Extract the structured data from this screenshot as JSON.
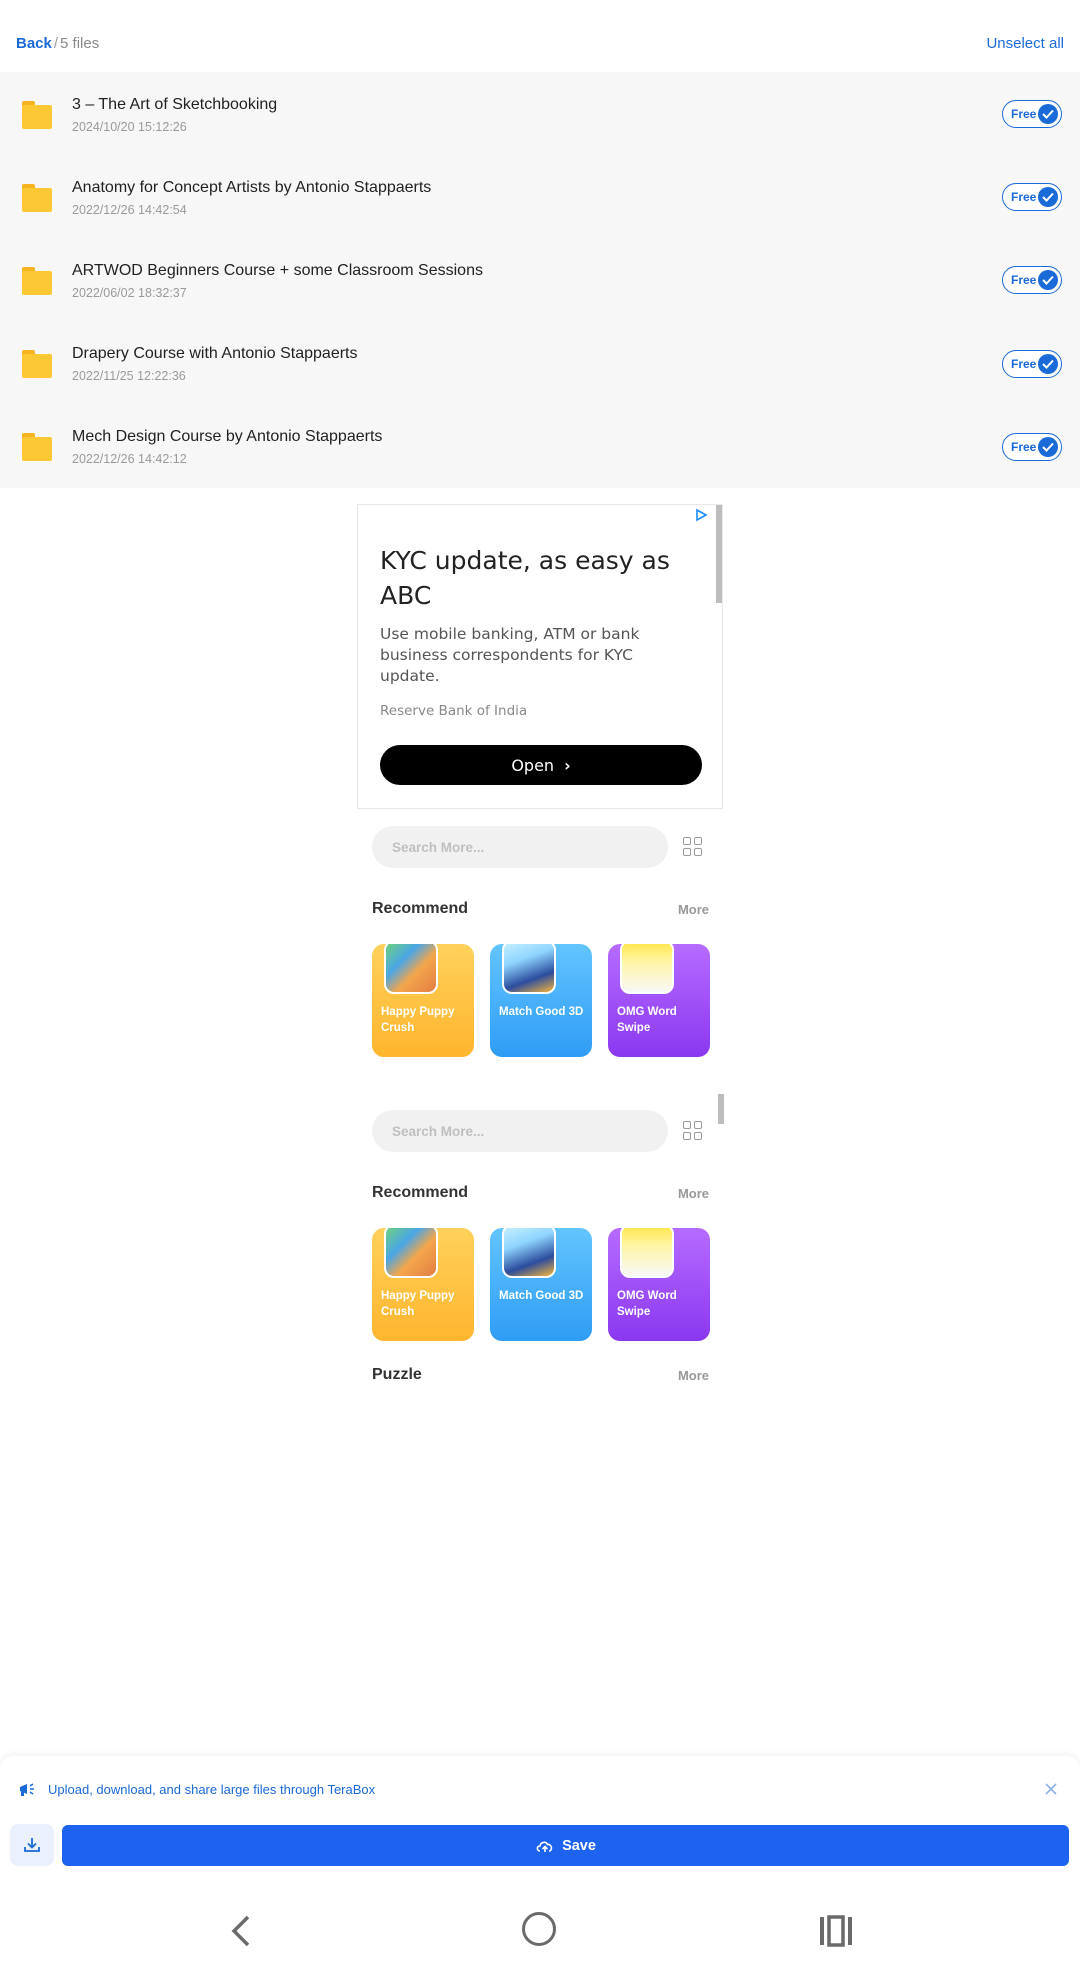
{
  "header": {
    "back_label": "Back",
    "separator": "/",
    "file_count": "5 files",
    "unselect_label": "Unselect all"
  },
  "files": [
    {
      "name": "3 – The Art of Sketchbooking",
      "date": "2024/10/20 15:12:26",
      "badge": "Free"
    },
    {
      "name": "Anatomy for Concept Artists by Antonio Stappaerts",
      "date": "2022/12/26 14:42:54",
      "badge": "Free"
    },
    {
      "name": "ARTWOD Beginners Course + some Classroom Sessions",
      "date": "2022/06/02 18:32:37",
      "badge": "Free"
    },
    {
      "name": "Drapery Course with Antonio Stappaerts",
      "date": "2022/11/25 12:22:36",
      "badge": "Free"
    },
    {
      "name": "Mech Design Course by Antonio Stappaerts",
      "date": "2022/12/26 14:42:12",
      "badge": "Free"
    }
  ],
  "ad": {
    "headline": "KYC update, as easy as ABC",
    "body": "Use mobile banking, ATM or bank business correspondents for KYC update.",
    "source": "Reserve Bank of India",
    "button": "Open",
    "choice_icon": "ad-choices-icon"
  },
  "games_widget_1": {
    "search_placeholder": "Search More...",
    "recommend_title": "Recommend",
    "more_label": "More",
    "games": [
      {
        "name": "Happy Puppy Crush"
      },
      {
        "name": "Match Good 3D"
      },
      {
        "name": "OMG Word Swipe"
      }
    ]
  },
  "games_widget_2": {
    "search_placeholder": "Search More...",
    "recommend_title": "Recommend",
    "more_label": "More",
    "games": [
      {
        "name": "Happy Puppy Crush"
      },
      {
        "name": "Match Good 3D"
      },
      {
        "name": "OMG Word Swipe"
      }
    ],
    "puzzle_title": "Puzzle",
    "puzzle_more": "More"
  },
  "bottom": {
    "promo_text": "Upload, download, and share large files through TeraBox",
    "save_label": "Save"
  },
  "colors": {
    "accent": "#1a6ad8",
    "save_button": "#1e63f0",
    "folder": "#fcc934"
  }
}
